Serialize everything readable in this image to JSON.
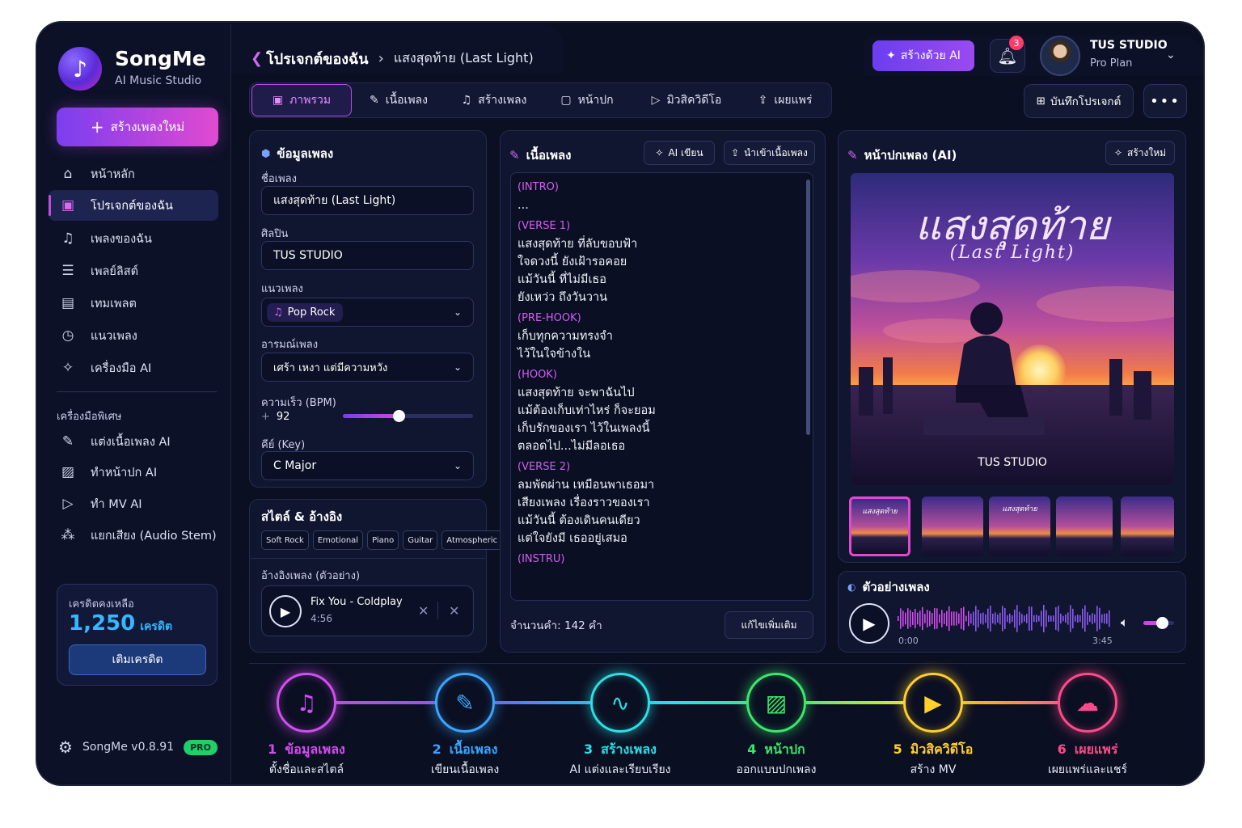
{
  "app": {
    "name": "SongMe",
    "subtitle": "AI Music Studio",
    "version": "SongMe v0.8.91",
    "plan_badge": "PRO"
  },
  "sidebar": {
    "new_song": "สร้างเพลงใหม่",
    "items": [
      {
        "label": "หน้าหลัก",
        "icon": "home-icon"
      },
      {
        "label": "โปรเจกต์ของฉัน",
        "icon": "folder-icon"
      },
      {
        "label": "เพลงของฉัน",
        "icon": "music-note-icon"
      },
      {
        "label": "เพลย์ลิสต์",
        "icon": "playlist-icon"
      },
      {
        "label": "เทมเพลต",
        "icon": "template-icon"
      },
      {
        "label": "แนวเพลง",
        "icon": "genre-icon"
      },
      {
        "label": "เครื่องมือ AI",
        "icon": "sparkle-icon"
      }
    ],
    "special_title": "เครื่องมือพิเศษ",
    "special": [
      {
        "label": "แต่งเนื้อเพลง AI",
        "icon": "edit-icon"
      },
      {
        "label": "ทำหน้าปก AI",
        "icon": "image-icon"
      },
      {
        "label": "ทำ MV AI",
        "icon": "video-icon"
      },
      {
        "label": "แยกเสียง (Audio Stem)",
        "icon": "stem-icon"
      }
    ],
    "credits": {
      "label": "เครดิตคงเหลือ",
      "value": "1,250",
      "unit": "เครดิต",
      "button": "เติมเครดิต"
    }
  },
  "header": {
    "breadcrumb_root": "โปรเจกต์ของฉัน",
    "breadcrumb_current": "แสงสุดท้าย (Last Light)",
    "ai_button": "สร้างด้วย AI",
    "notifications": "3",
    "user_name": "TUS STUDIO",
    "user_plan": "Pro Plan"
  },
  "tabs": [
    {
      "label": "ภาพรวม",
      "icon": "overview-icon"
    },
    {
      "label": "เนื้อเพลง",
      "icon": "lyrics-icon"
    },
    {
      "label": "สร้างเพลง",
      "icon": "music-create-icon"
    },
    {
      "label": "หน้าปก",
      "icon": "cover-icon"
    },
    {
      "label": "มิวสิควิดีโอ",
      "icon": "video-play-icon"
    },
    {
      "label": "เผยแพร่",
      "icon": "publish-icon"
    }
  ],
  "actions": {
    "save": "บันทึกโปรเจกต์",
    "more": "•••"
  },
  "song_info": {
    "title": "ข้อมูลเพลง",
    "name_label": "ชื่อเพลง",
    "name": "แสงสุดท้าย (Last Light)",
    "artist_label": "ศิลปิน",
    "artist": "TUS STUDIO",
    "genre_label": "แนวเพลง",
    "genre": "Pop Rock",
    "mood_label": "อารมณ์เพลง",
    "mood": "เศร้า เหงา แต่มีความหวัง",
    "bpm_label": "ความเร็ว (BPM)",
    "bpm": "92",
    "bpm_fraction": 0.43,
    "key_label": "คีย์ (Key)",
    "key": "C Major"
  },
  "style": {
    "title": "สไตล์ & อ้างอิง",
    "tags": [
      "Soft Rock",
      "Emotional",
      "Piano",
      "Guitar",
      "Atmospheric"
    ],
    "ref_label": "อ้างอิงเพลง (ตัวอย่าง)",
    "ref_title": "Fix You - Coldplay",
    "ref_time": "4:56"
  },
  "lyrics": {
    "title": "เนื้อเพลง",
    "ai_write": "AI เขียน",
    "import": "นำเข้าเนื้อเพลง",
    "word_count": "จำนวนคำ: 142 คำ",
    "edit_more": "แก้ไขเพิ่มเติม",
    "lines": [
      {
        "text": "(INTRO)",
        "sec": true
      },
      {
        "text": "...",
        "sec": false
      },
      {
        "text": "(VERSE 1)",
        "sec": true
      },
      {
        "text": "แสงสุดท้าย ที่ลับขอบฟ้า",
        "sec": false
      },
      {
        "text": "ใจดวงนี้ ยังเฝ้ารอคอย",
        "sec": false
      },
      {
        "text": "แม้วันนี้ ที่ไม่มีเธอ",
        "sec": false
      },
      {
        "text": "ยังเหว่ว ถึงวันวาน",
        "sec": false
      },
      {
        "text": "(PRE-HOOK)",
        "sec": true
      },
      {
        "text": "เก็บทุกความทรงจำ",
        "sec": false
      },
      {
        "text": "ไว้ในใจข้างใน",
        "sec": false
      },
      {
        "text": "(HOOK)",
        "sec": true
      },
      {
        "text": "แสงสุดท้าย จะพาฉันไป",
        "sec": false
      },
      {
        "text": "แม้ต้องเก็บเท่าไหร่ ก็จะยอม",
        "sec": false
      },
      {
        "text": "เก็บรักของเรา ไว้ในเพลงนี้",
        "sec": false
      },
      {
        "text": "ตลอดไป...ไม่มีลอเธอ",
        "sec": false
      },
      {
        "text": "(VERSE 2)",
        "sec": true
      },
      {
        "text": "ลมพัดผ่าน เหมือนพาเธอมา",
        "sec": false
      },
      {
        "text": "เสียงเพลง เรื่องราวของเรา",
        "sec": false
      },
      {
        "text": "แม้วันนี้ ต้องเดินคนเดียว",
        "sec": false
      },
      {
        "text": "แต่ใจยังมี เธออยู่เสมอ",
        "sec": false
      },
      {
        "text": "(INSTRU)",
        "sec": true
      }
    ]
  },
  "cover": {
    "title": "หน้าปกเพลง (AI)",
    "new_button": "สร้างใหม่",
    "art_title": "แสงสุดท้าย",
    "art_subtitle": "(Last Light)",
    "art_credit": "TUS STUDIO",
    "thumb_title": "แสงสุดท้าย"
  },
  "preview": {
    "title": "ตัวอย่างเพลง",
    "start": "0:00",
    "end": "3:45",
    "volume": 0.6
  },
  "steps": [
    {
      "num": "1",
      "title": "ข้อมูลเพลง",
      "sub": "ตั้งชื่อและสไตล์",
      "color": "#d24ef0",
      "icon": "music-note-icon"
    },
    {
      "num": "2",
      "title": "เนื้อเพลง",
      "sub": "เขียนเนื้อเพลง",
      "color": "#3aa6ff",
      "icon": "pencil-icon"
    },
    {
      "num": "3",
      "title": "สร้างเพลง",
      "sub": "AI แต่งและเรียบเรียง",
      "color": "#2ae0e6",
      "icon": "waveform-icon"
    },
    {
      "num": "4",
      "title": "หน้าปก",
      "sub": "ออกแบบปกเพลง",
      "color": "#3ae86a",
      "icon": "image-icon"
    },
    {
      "num": "5",
      "title": "มิวสิควิดีโอ",
      "sub": "สร้าง MV",
      "color": "#ffd02a",
      "icon": "video-camera-icon"
    },
    {
      "num": "6",
      "title": "เผยแพร่",
      "sub": "เผยแพร่และแชร์",
      "color": "#ff4a8a",
      "icon": "cloud-upload-icon"
    }
  ]
}
